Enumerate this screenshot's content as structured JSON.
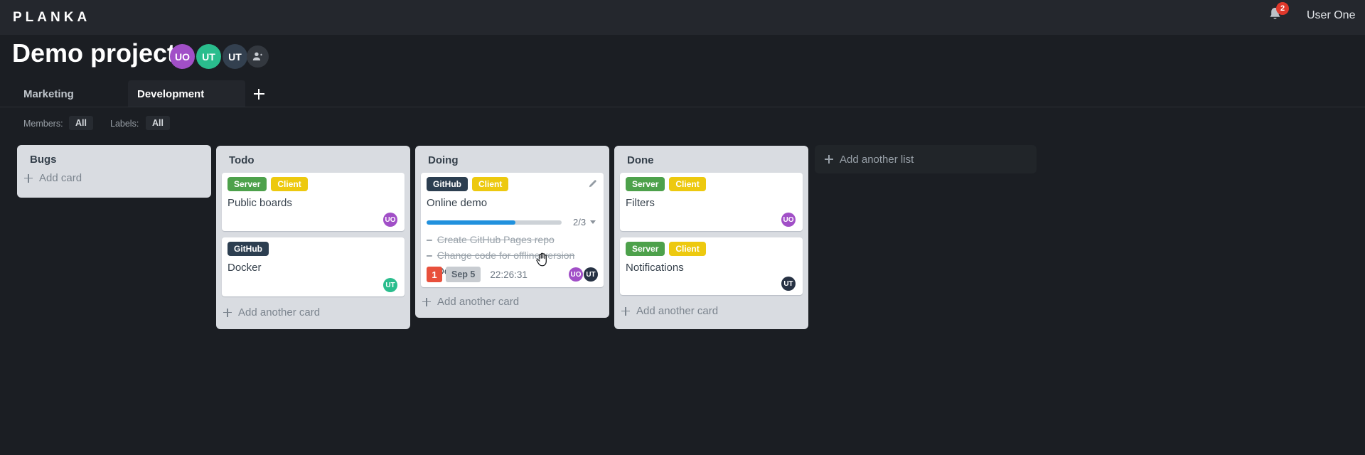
{
  "header": {
    "logo": "PLANKA",
    "notification_count": "2",
    "user_name": "User One"
  },
  "project": {
    "title": "Demo project",
    "members": [
      {
        "initials": "UO",
        "color": "#a14fc7"
      },
      {
        "initials": "UT",
        "color": "#2abd8d"
      },
      {
        "initials": "UT",
        "color": "#33404f"
      }
    ]
  },
  "tabs": {
    "items": [
      {
        "label": "Marketing",
        "active": false
      },
      {
        "label": "Development",
        "active": true
      }
    ]
  },
  "filters": {
    "members_label": "Members:",
    "members_value": "All",
    "labels_label": "Labels:",
    "labels_value": "All"
  },
  "board": {
    "add_list_label": "Add another list",
    "lists": [
      {
        "title": "Bugs",
        "add_card_label": "Add card",
        "cards": []
      },
      {
        "title": "Todo",
        "add_card_label": "Add another card",
        "cards": [
          {
            "title": "Public boards",
            "labels": [
              "Server",
              "Client"
            ],
            "member": "UO"
          },
          {
            "title": "Docker",
            "labels": [
              "GitHub"
            ],
            "member": "UT"
          }
        ]
      },
      {
        "title": "Doing",
        "add_card_label": "Add another card",
        "cards": [
          {
            "title": "Online demo",
            "labels": [
              "GitHub",
              "Client"
            ],
            "progress_label": "2/3",
            "progress_percent": 66,
            "tasks": [
              {
                "text": "Create GitHub Pages repo",
                "done": true
              },
              {
                "text": "Change code for offline version",
                "done": true
              },
              {
                "text": "Deploy",
                "done": false
              }
            ],
            "notification_badge": "1",
            "due_date": "Sep 5",
            "stopwatch": "22:26:31",
            "members": [
              "UO",
              "UT"
            ]
          }
        ]
      },
      {
        "title": "Done",
        "add_card_label": "Add another card",
        "cards": [
          {
            "title": "Filters",
            "labels": [
              "Server",
              "Client"
            ],
            "member": "UO"
          },
          {
            "title": "Notifications",
            "labels": [
              "Server",
              "Client"
            ],
            "member": "UT"
          }
        ]
      }
    ]
  },
  "colors": {
    "label_server": "#4da14b",
    "label_client": "#edc90f",
    "label_github": "#2c3e50",
    "avatar_uo": "#a14fc7",
    "avatar_ut_teal": "#2abd8d",
    "avatar_ut_slate": "#33404f",
    "avatar_ut_navy": "#263143",
    "notification_red": "#e8503c",
    "badge_red": "#e0382b",
    "progress_blue": "#2191dd",
    "list_bg": "#d9dce1",
    "header_bg": "#24272d",
    "page_bg": "#1b1e23"
  },
  "icons": {
    "bell": "bell-icon",
    "add_member": "user-plus-icon",
    "pencil": "pencil-icon",
    "hand": "hand-cursor"
  }
}
